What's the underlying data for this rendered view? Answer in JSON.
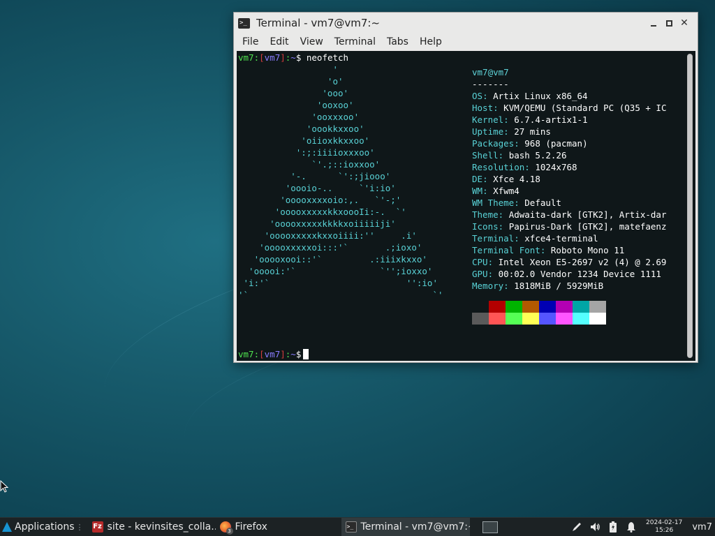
{
  "window": {
    "title": "Terminal - vm7@vm7:~",
    "menu": [
      "File",
      "Edit",
      "View",
      "Terminal",
      "Tabs",
      "Help"
    ]
  },
  "terminal": {
    "prompt": {
      "user": "vm7",
      "host": "vm7",
      "path": "~",
      "symbol": "$"
    },
    "command": "neofetch",
    "art": [
      "                  '",
      "                 'o'",
      "                'ooo'",
      "               'ooxoo'",
      "              'ooxxxoo'",
      "             'oookkxxoo'",
      "            'oiioxkkxxoo'",
      "           ':;:iiiioxxxoo'",
      "              `'.;::ioxxoo'",
      "          '-.      `':;jiooo'",
      "         'oooio-..     `'i:io'",
      "        'ooooxxxxoio:,.   `'-;'",
      "       'ooooxxxxxkkxoooIi:-.  `'",
      "      'ooooxxxxxkkkkxoiiiiiji'",
      "     'ooooxxxxxkxxoiiii:''     .i'",
      "    'ooooxxxxxoi:::'`       .;ioxo'",
      "   'ooooxooi::'`         .:iiixkxxo'",
      "  'ooooi:'`                `'';ioxxo'",
      " 'i:'`                          '':io'",
      "'`                                   `'"
    ],
    "header_user": "vm7@vm7",
    "header_rule": "-------",
    "info": [
      {
        "key": "OS",
        "value": "Artix Linux x86_64"
      },
      {
        "key": "Host",
        "value": "KVM/QEMU (Standard PC (Q35 + IC"
      },
      {
        "key": "Kernel",
        "value": "6.7.4-artix1-1"
      },
      {
        "key": "Uptime",
        "value": "27 mins"
      },
      {
        "key": "Packages",
        "value": "968 (pacman)"
      },
      {
        "key": "Shell",
        "value": "bash 5.2.26"
      },
      {
        "key": "Resolution",
        "value": "1024x768"
      },
      {
        "key": "DE",
        "value": "Xfce 4.18"
      },
      {
        "key": "WM",
        "value": "Xfwm4"
      },
      {
        "key": "WM Theme",
        "value": "Default"
      },
      {
        "key": "Theme",
        "value": "Adwaita-dark [GTK2], Artix-dar"
      },
      {
        "key": "Icons",
        "value": "Papirus-Dark [GTK2], matefaenz"
      },
      {
        "key": "Terminal",
        "value": "xfce4-terminal"
      },
      {
        "key": "Terminal Font",
        "value": "Roboto Mono 11"
      },
      {
        "key": "CPU",
        "value": "Intel Xeon E5-2697 v2 (4) @ 2.69"
      },
      {
        "key": "GPU",
        "value": "00:02.0 Vendor 1234 Device 1111"
      },
      {
        "key": "Memory",
        "value": "1818MiB / 5929MiB"
      }
    ],
    "palette_top": [
      "#0f1719",
      "#b30000",
      "#00b300",
      "#b35900",
      "#0000b3",
      "#b300b3",
      "#00a5a5",
      "#a5a5a5"
    ],
    "palette_bottom": [
      "#5a5a5a",
      "#ff5555",
      "#55ff55",
      "#ffff55",
      "#5555ff",
      "#ff55ff",
      "#55ffff",
      "#ffffff"
    ]
  },
  "taskbar": {
    "applications_label": "Applications",
    "tasks": [
      {
        "label": "site - kevinsites_colla...",
        "icon": "filezilla-icon"
      },
      {
        "label": "Firefox",
        "icon": "firefox-icon",
        "badge": "3"
      },
      {
        "label": "Terminal - vm7@vm7:~",
        "icon": "terminal-icon"
      }
    ],
    "clock": {
      "date": "2024-02-17",
      "time": "15:26"
    },
    "user": "vm7"
  }
}
